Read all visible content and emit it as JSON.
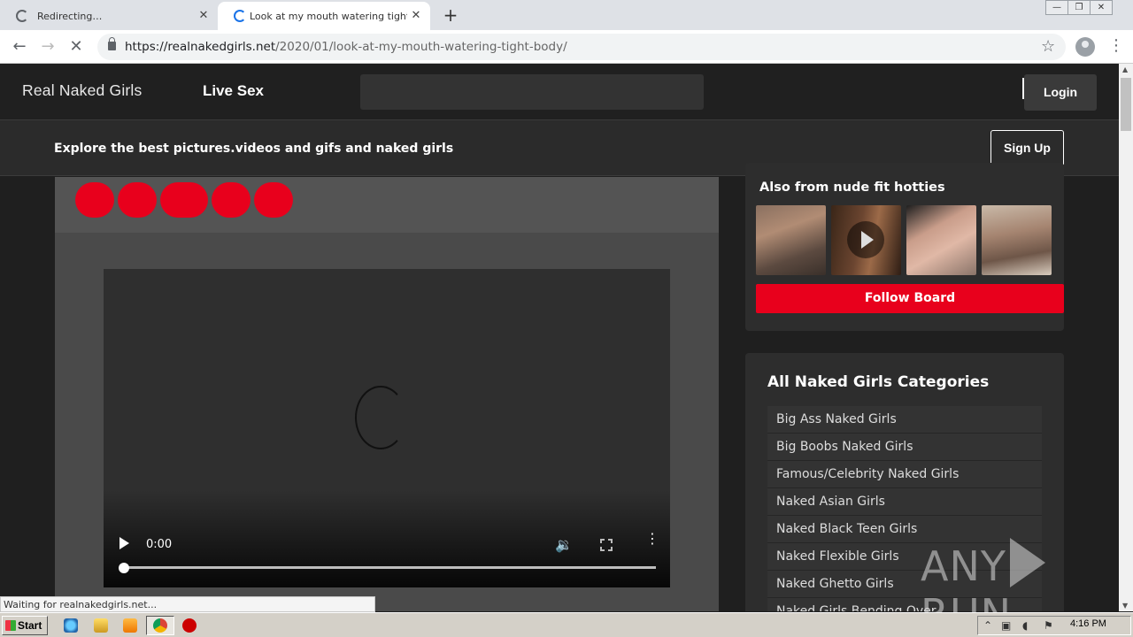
{
  "browser": {
    "tabs": [
      {
        "title": "Redirecting…",
        "loading": true
      },
      {
        "title": "Look at my mouth watering tight body",
        "loading": true,
        "active": true
      }
    ],
    "new_tab_icon": "plus-icon",
    "url_host": "https://realnakedgirls.net",
    "url_path": "/2020/01/look-at-my-mouth-watering-tight-body/",
    "status_text": "Waiting for realnakedgirls.net..."
  },
  "site": {
    "logo": "Real Naked Girls",
    "nav_live_sex": "Live Sex",
    "search_placeholder": "",
    "login_label": "Login",
    "promo_text": "Explore the best pictures.videos and gifs and naked girls",
    "signup_label": "Sign Up",
    "accent_color": "#e8001c"
  },
  "video": {
    "time": "0:00",
    "progress": 0
  },
  "board": {
    "title": "Also from nude fit hotties",
    "follow_label": "Follow Board"
  },
  "categories": {
    "title": "All Naked Girls Categories",
    "items": [
      "Big Ass Naked Girls",
      "Big Boobs Naked Girls",
      "Famous/Celebrity Naked Girls",
      "Naked Asian Girls",
      "Naked Black Teen Girls",
      "Naked Flexible Girls",
      "Naked Ghetto Girls",
      "Naked Girls Bending Over"
    ]
  },
  "watermark": {
    "left": "ANY",
    "right": "RUN"
  },
  "taskbar": {
    "start_label": "Start",
    "clock": "4:16 PM"
  }
}
